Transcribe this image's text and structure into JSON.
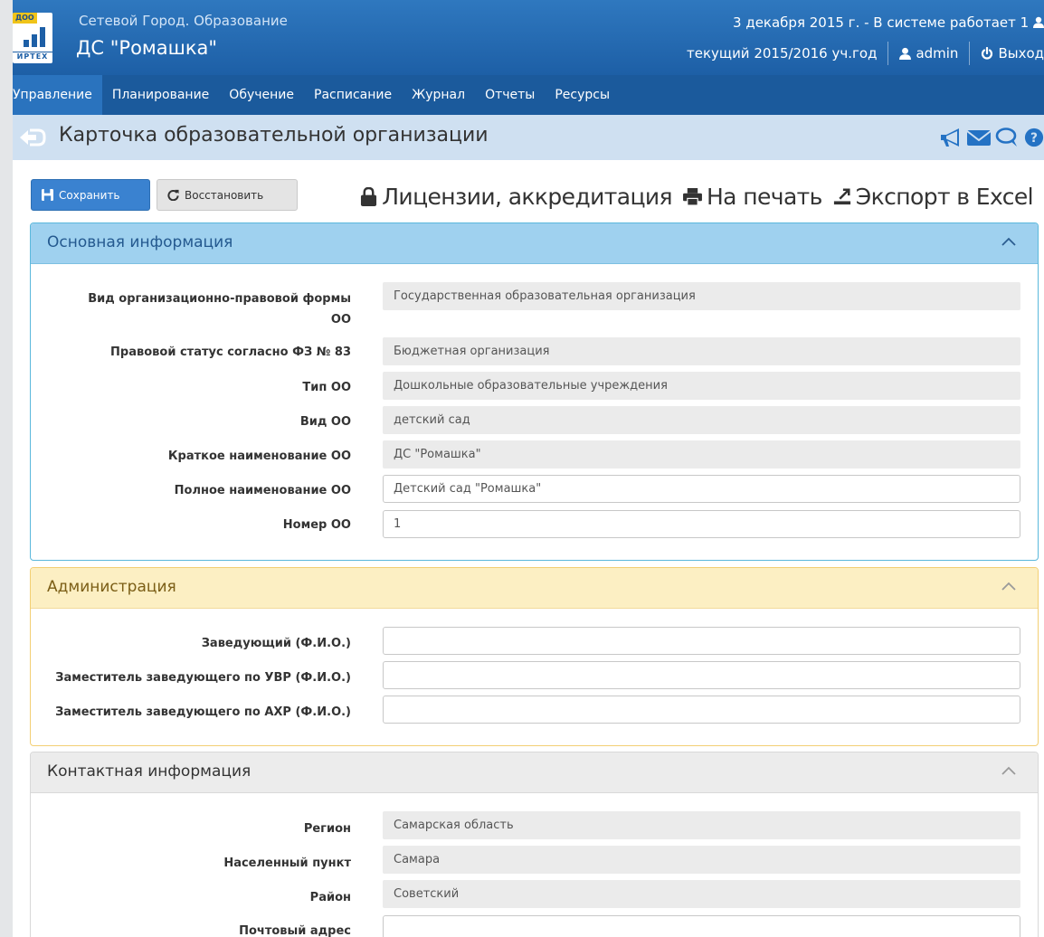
{
  "header": {
    "logo_tag": "ДОО",
    "logo_text": "ИРТЕХ",
    "app_name": "Сетевой Город. Образование",
    "org_name": "ДС \"Ромашка\"",
    "date_status": "3 декабря 2015 г. - В системе работает 1",
    "school_year": "текущий 2015/2016 уч.год",
    "user": "admin",
    "logout": "Выход"
  },
  "nav": {
    "items": [
      "Управление",
      "Планирование",
      "Обучение",
      "Расписание",
      "Журнал",
      "Отчеты",
      "Ресурсы"
    ],
    "active_index": 0
  },
  "page": {
    "title": "Карточка образовательной организации",
    "title_icons": [
      "megaphone-icon",
      "mail-icon",
      "chat-icon",
      "help-icon"
    ]
  },
  "toolbar": {
    "save_label": "Сохранить",
    "restore_label": "Восстановить",
    "licenses_label": "Лицензии, аккредитация",
    "print_label": "На печать",
    "export_label": "Экспорт в Excel"
  },
  "panels": {
    "main": {
      "title": "Основная информация",
      "fields": [
        {
          "label_1": "Вид организационно-правовой формы",
          "label_2": "ОО",
          "value": "Государственная образовательная организация",
          "editable": false
        },
        {
          "label": "Правовой статус согласно ФЗ № 83",
          "value": "Бюджетная организация",
          "editable": false
        },
        {
          "label": "Тип ОО",
          "value": "Дошкольные образовательные учреждения",
          "editable": false
        },
        {
          "label": "Вид ОО",
          "value": "детский сад",
          "editable": false
        },
        {
          "label": "Краткое наименование ОО",
          "value": "ДС \"Ромашка\"",
          "editable": false
        },
        {
          "label": "Полное наименование ОО",
          "value": "Детский сад \"Ромашка\"",
          "editable": true
        },
        {
          "label": "Номер ОО",
          "value": "1",
          "editable": true
        }
      ]
    },
    "admin": {
      "title": "Администрация",
      "fields": [
        {
          "label": "Заведующий (Ф.И.О.)",
          "value": ""
        },
        {
          "label": "Заместитель заведующего по УВР (Ф.И.О.)",
          "value": ""
        },
        {
          "label": "Заместитель заведующего по АХР (Ф.И.О.)",
          "value": ""
        }
      ]
    },
    "contact": {
      "title": "Контактная информация",
      "fields": [
        {
          "label": "Регион",
          "value": "Самарская область",
          "editable": false
        },
        {
          "label": "Населенный пункт",
          "value": "Самара",
          "editable": false
        },
        {
          "label": "Район",
          "value": "Советский",
          "editable": false
        },
        {
          "label": "Почтовый адрес",
          "value": "",
          "editable": true
        }
      ]
    }
  },
  "colors": {
    "header_blue": "#2a6db5",
    "nav_blue": "#1b5a9c",
    "save_button": "#3a82d0",
    "main_panel_head": "#9fd1ef",
    "admin_panel_head": "#fcefc3",
    "contact_panel_head": "#ececec"
  }
}
